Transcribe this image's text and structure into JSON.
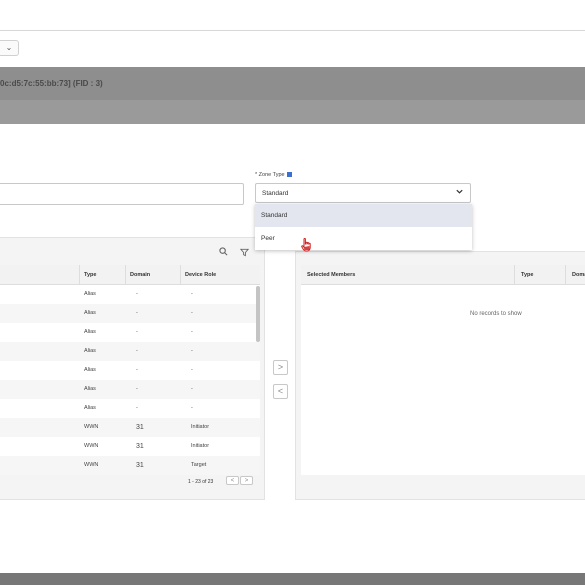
{
  "banner": {
    "title": "0c:d5:7c:55:bb:73] (FID : 3)"
  },
  "zone_type": {
    "label": "* Zone Type",
    "selected": "Standard",
    "options": [
      "Standard",
      "Peer"
    ]
  },
  "left_table": {
    "columns": [
      "Type",
      "Domain",
      "Device Role"
    ],
    "rows": [
      {
        "type": "Alias",
        "domain": "-",
        "role": "-"
      },
      {
        "type": "Alias",
        "domain": "-",
        "role": "-"
      },
      {
        "type": "Alias",
        "domain": "-",
        "role": "-"
      },
      {
        "type": "Alias",
        "domain": "-",
        "role": "-"
      },
      {
        "type": "Alias",
        "domain": "-",
        "role": "-"
      },
      {
        "type": "Alias",
        "domain": "-",
        "role": "-"
      },
      {
        "type": "Alias",
        "domain": "-",
        "role": "-"
      },
      {
        "type": "WWN",
        "domain": "31",
        "role": "Initiator"
      },
      {
        "type": "WWN",
        "domain": "31",
        "role": "Initiator"
      },
      {
        "type": "WWN",
        "domain": "31",
        "role": "Target"
      }
    ],
    "pager": {
      "range": "1 - 23",
      "of_label": "of",
      "total": "23",
      "prev": "<",
      "next": ">"
    }
  },
  "move_buttons": {
    "add": ">",
    "remove": "<"
  },
  "right_table": {
    "columns": [
      "Selected Members",
      "Type",
      "Doma"
    ],
    "empty_text": "No records to show"
  },
  "icons": {
    "search": "search-icon",
    "filter": "filter-icon",
    "chevron": "chevron-down-icon",
    "cursor": "hand-pointer-icon"
  },
  "colors": {
    "banner": "#8e8e8e",
    "selected_option": "#e3e6ef",
    "cursor": "#cc2222"
  }
}
